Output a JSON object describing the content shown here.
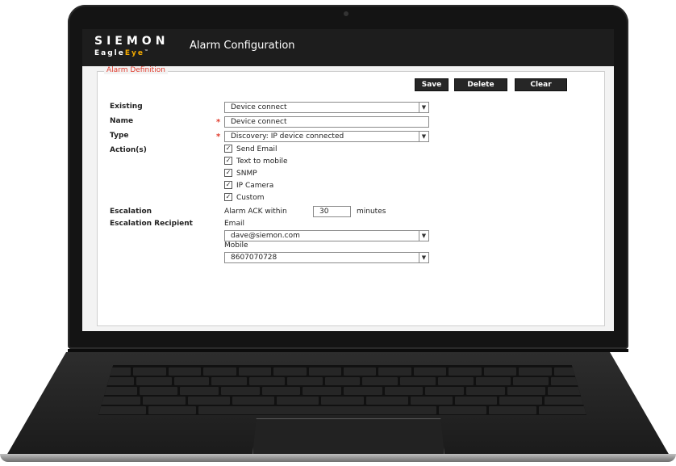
{
  "header": {
    "brand_top": "SIEMON",
    "brand_bottom_a": "Eagle",
    "brand_bottom_b": "Eye",
    "brand_tm": "™",
    "title": "Alarm Configuration"
  },
  "form": {
    "legend": "Alarm Definition",
    "buttons": {
      "save": "Save",
      "delete": "Delete",
      "clear": "Clear"
    },
    "existing": {
      "label": "Existing",
      "value": "Device connect"
    },
    "name": {
      "label": "Name",
      "value": "Device connect"
    },
    "type": {
      "label": "Type",
      "value": "Discovery: IP device connected"
    },
    "actions": {
      "label": "Action(s)",
      "items": [
        {
          "label": "Send Email",
          "checked": true
        },
        {
          "label": "Text to mobile",
          "checked": true
        },
        {
          "label": "SNMP",
          "checked": true
        },
        {
          "label": "IP Camera",
          "checked": true
        },
        {
          "label": "Custom",
          "checked": true
        }
      ]
    },
    "escalation": {
      "label": "Escalation",
      "prefix": "Alarm ACK within",
      "value": "30",
      "suffix": "minutes"
    },
    "recipient": {
      "label": "Escalation Recipient",
      "email_label": "Email",
      "email_value": "dave@siemon.com",
      "mobile_label": "Mobile",
      "mobile_value": "8607070728"
    }
  },
  "colors": {
    "accent_red": "#e03a2b",
    "brand_orange": "#f2a900",
    "header_bg": "#1d1d1d"
  },
  "icons": {
    "dropdown": "chevron-down-icon",
    "checkbox": "checkmark-icon"
  }
}
